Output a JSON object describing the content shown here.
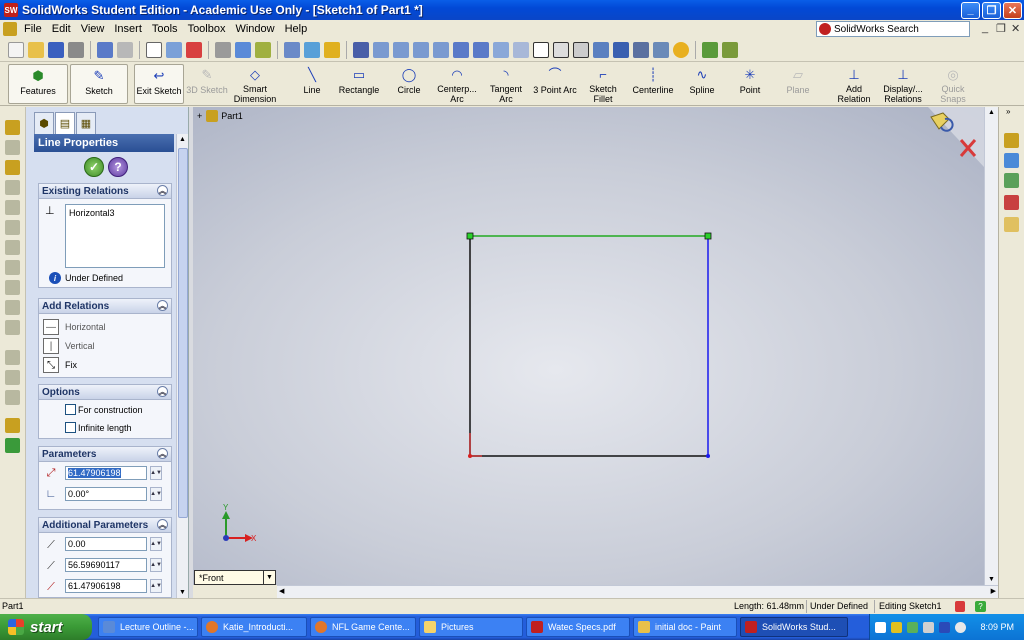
{
  "window": {
    "title": "SolidWorks Student Edition - Academic Use Only - [Sketch1 of Part1 *]",
    "icon_label": "SW"
  },
  "menubar": {
    "items": [
      "File",
      "Edit",
      "View",
      "Insert",
      "Tools",
      "Toolbox",
      "Window",
      "Help"
    ],
    "search_placeholder": "SolidWorks Search"
  },
  "commandmanager": {
    "features": "Features",
    "sketch": "Sketch",
    "exit_sketch": "Exit Sketch",
    "sketch3d": "3D Sketch",
    "smart_dimension": "Smart Dimension",
    "line": "Line",
    "rectangle": "Rectangle",
    "circle": "Circle",
    "centerpoint_arc": "Centerp... Arc",
    "tangent_arc": "Tangent Arc",
    "three_point_arc": "3 Point Arc",
    "sketch_fillet": "Sketch Fillet",
    "centerline": "Centerline",
    "spline": "Spline",
    "point": "Point",
    "plane": "Plane",
    "add_relation": "Add Relation",
    "display_relations": "Display/... Relations",
    "quick_snaps": "Quick Snaps"
  },
  "property_manager": {
    "title": "Line Properties",
    "existing_relations": {
      "header": "Existing Relations",
      "items": [
        "Horizontal3"
      ],
      "status": "Under Defined"
    },
    "add_relations": {
      "header": "Add Relations",
      "horizontal": "Horizontal",
      "vertical": "Vertical",
      "fix": "Fix"
    },
    "options": {
      "header": "Options",
      "for_construction": "For construction",
      "infinite_length": "Infinite length"
    },
    "parameters": {
      "header": "Parameters",
      "length": "61.47906198",
      "angle": "0.00°"
    },
    "additional_parameters": {
      "header": "Additional Parameters",
      "start_x": "0.00",
      "start_y": "56.59690117",
      "end_x": "61.47906198"
    }
  },
  "graphics": {
    "tree_root": "Part1",
    "view_orientation": "*Front"
  },
  "statusbar": {
    "part": "Part1",
    "length": "Length: 61.48mm",
    "defined": "Under Defined",
    "editing": "Editing Sketch1"
  },
  "taskbar": {
    "start": "start",
    "tasks": [
      {
        "label": "Lecture Outline -...",
        "color": "#5a8ad8"
      },
      {
        "label": "Katie_Introducti...",
        "color": "#e0762a"
      },
      {
        "label": "NFL Game Cente...",
        "color": "#e0762a"
      },
      {
        "label": "Pictures",
        "color": "#f4d36a"
      },
      {
        "label": "Watec Specs.pdf",
        "color": "#c02020"
      },
      {
        "label": "initial doc - Paint",
        "color": "#e8c04a"
      },
      {
        "label": "SolidWorks Stud...",
        "color": "#c02020"
      }
    ],
    "clock": "8:09 PM"
  },
  "colors": {
    "accent": "#245edb",
    "selected_edge": "#22aa22",
    "sketch_line": "#1a1aee"
  }
}
